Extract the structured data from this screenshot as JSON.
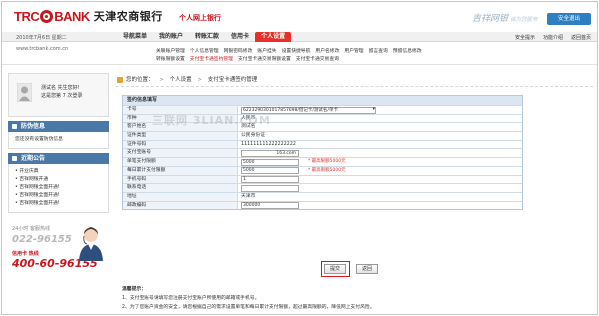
{
  "header": {
    "logo_trc": "TRC",
    "logo_bank": "BANK",
    "logo_cn": "天津农商银行",
    "logo_sub": "个人网上银行",
    "slogan": "吉祥网银",
    "slogan_small": "诚为您服务",
    "logout": "安全退出"
  },
  "nav": {
    "date": "2010年7月6日 星期二",
    "items": [
      "导航菜单",
      "我的账户",
      "转账汇款",
      "信用卡",
      "个人设置"
    ],
    "util": [
      "安全提示",
      "功能介绍",
      "返回首页"
    ]
  },
  "url": "www.trcbank.com.cn",
  "submenu": {
    "row1": [
      "关联账户管理",
      "个人信息管理",
      "网银密码修改",
      "账户挂失",
      "设置快捷导航",
      "用户名修改",
      "用户管理",
      "留言查询",
      "预留信息修改"
    ],
    "row2": [
      "转账限额设置",
      "支付宝卡通签约管理",
      "支付宝卡通交易限额设置",
      "支付宝卡通交易查询"
    ]
  },
  "sidebar": {
    "welcome_line1": "测试名 先生您好!",
    "welcome_line2": "这是您第 7 次登录",
    "fraud_title": "防伪信息",
    "fraud_body": "您还没有设置防伪信息",
    "notice_title": "近期公告",
    "notices": [
      "开业庆典",
      "吉祥网银开通",
      "吉祥网银全面开通!",
      "吉祥网银全面开通!",
      "吉祥网银全面开通!"
    ],
    "hotline_label": "24小时 客服热线",
    "hotline1": "022-96155",
    "card_label": "信用卡 热线",
    "hotline2": "400-60-96155"
  },
  "breadcrumb": {
    "root": "您的位置：",
    "level1": "个人设置",
    "level2": "支付宝卡通签约管理"
  },
  "form": {
    "title": "签约信息填写",
    "rows": [
      {
        "label": "卡号",
        "type": "select",
        "value": "6223290301017857098/借记卡/测试名/单卡"
      },
      {
        "label": "币种",
        "type": "text",
        "value": "人民币"
      },
      {
        "label": "客户姓名",
        "type": "text",
        "value": "测试名"
      },
      {
        "label": "证件类型",
        "type": "text",
        "value": "公民身份证"
      },
      {
        "label": "证件号码",
        "type": "text",
        "value": "111111111222222222"
      },
      {
        "label": "支付宝账号",
        "type": "input",
        "value": "163.com",
        "required": true
      },
      {
        "label": "单笔支付限额",
        "type": "input",
        "value": "5000",
        "note": "* 最高限额5000元",
        "required": true
      },
      {
        "label": "每日累计支付限额",
        "type": "input",
        "value": "5000",
        "note": "* 最高限额5000元",
        "required": true
      },
      {
        "label": "手机号码",
        "type": "input",
        "value": "1",
        "required": true
      },
      {
        "label": "联系电话",
        "type": "input",
        "value": ""
      },
      {
        "label": "地址",
        "type": "text",
        "value": "天津市"
      },
      {
        "label": "邮政编码",
        "type": "input",
        "value": "300000"
      }
    ],
    "submit": "提交",
    "back": "返回"
  },
  "tips": {
    "title": "温馨提示：",
    "line1": "1、支付宝账号请填写您注册支付宝账户所使用的邮箱或手机号。",
    "line2": "2、为了您账户资金的安全，请您根据自己的需求设置单笔和每日累计支付限额，超过最高限额的，降低网上支付风险。"
  },
  "watermark": "三联网 3LIAN.COM"
}
